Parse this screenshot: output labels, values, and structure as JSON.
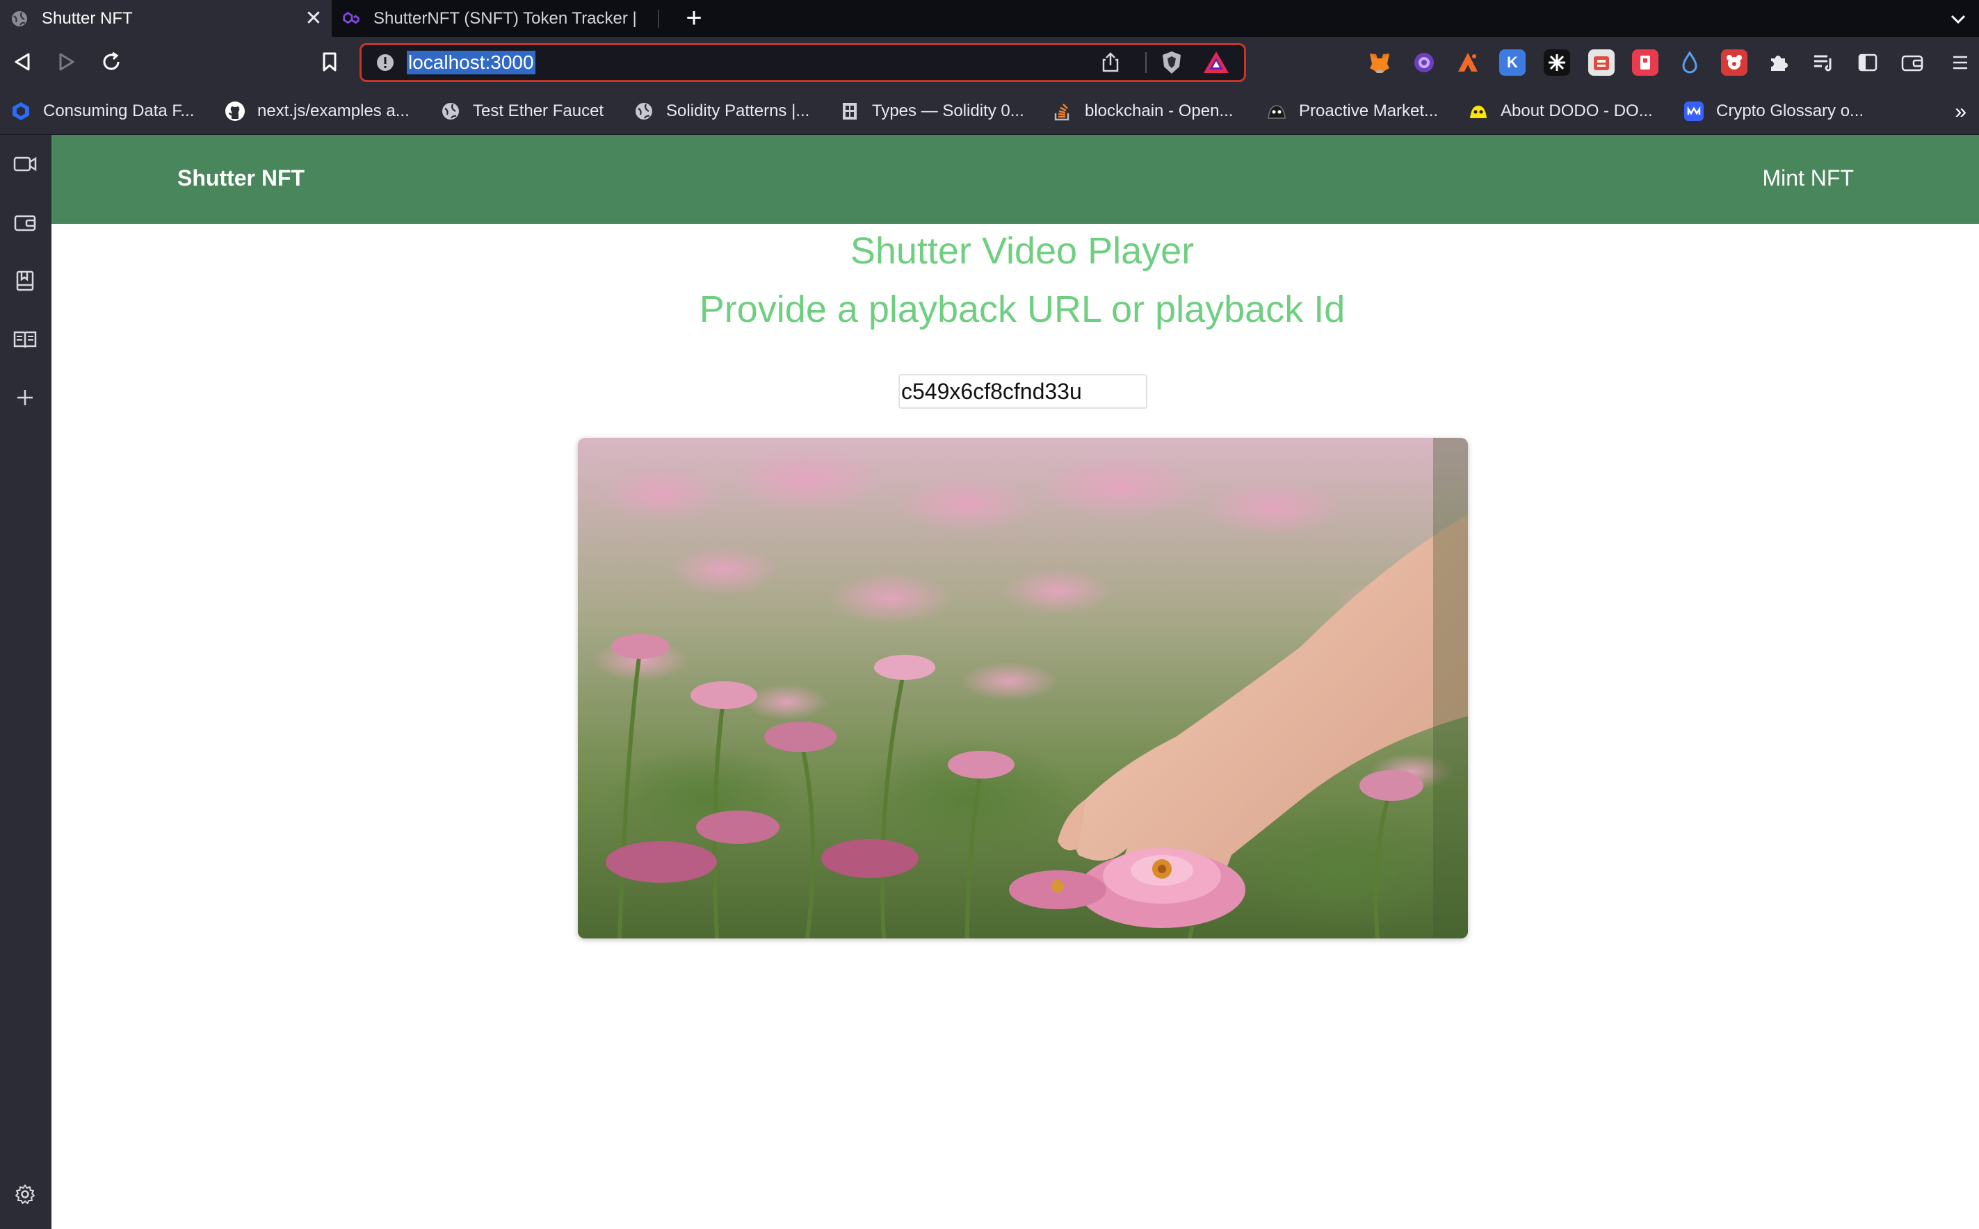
{
  "browser": {
    "tabs": [
      {
        "title": "Shutter NFT",
        "active": true,
        "icon": "globe-icon"
      },
      {
        "title": "ShutterNFT (SNFT) Token Tracker | ",
        "active": false,
        "icon": "polygon-icon"
      }
    ],
    "url": "localhost:3000",
    "extensions": [
      "metamask-icon",
      "extension-icon",
      "extension-icon",
      "k-extension-icon",
      "extension-icon",
      "extension-icon",
      "extension-icon",
      "drop-icon",
      "extension-icon",
      "puzzle-icon",
      "playlist-icon",
      "sidebar-icon",
      "wallet-icon",
      "menu-icon"
    ],
    "bookmarks": [
      {
        "label": "Consuming Data F...",
        "icon": "hexagon-icon"
      },
      {
        "label": "next.js/examples a...",
        "icon": "github-icon"
      },
      {
        "label": "Test Ether Faucet",
        "icon": "globe-icon"
      },
      {
        "label": "Solidity Patterns |...",
        "icon": "globe-icon"
      },
      {
        "label": "Types — Solidity 0...",
        "icon": "solidity-icon"
      },
      {
        "label": "blockchain - Open...",
        "icon": "stackoverflow-icon"
      },
      {
        "label": "Proactive Market...",
        "icon": "dodo-icon"
      },
      {
        "label": "About DODO - DO...",
        "icon": "dodo-icon"
      },
      {
        "label": "Crypto Glossary o...",
        "icon": "coinmarketcap-icon"
      }
    ]
  },
  "colors": {
    "navbar": "#4a865b",
    "heading": "#6fcf80",
    "url_highlight": "#3169c6",
    "url_border": "#c4362c"
  },
  "app": {
    "brand": "Shutter NFT",
    "nav_link": "Mint NFT",
    "title": "Shutter Video Player",
    "subtitle": "Provide a playback URL or playback Id",
    "playback_input_value": "c549x6cf8cfnd33u"
  }
}
